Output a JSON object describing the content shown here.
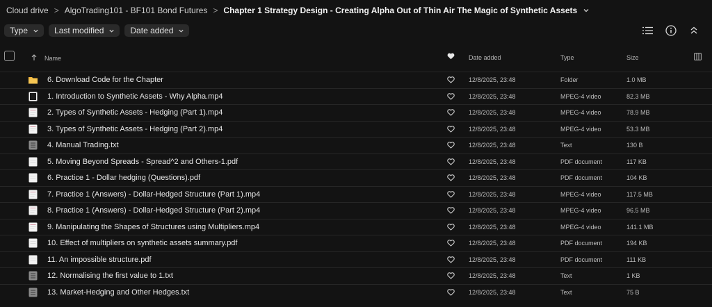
{
  "breadcrumb": {
    "items": [
      "Cloud drive",
      "AlgoTrading101 - BF101 Bond Futures",
      "Chapter 1 Strategy Design - Creating Alpha Out of Thin Air The Magic of Synthetic Assets"
    ],
    "separator": ">"
  },
  "filters": [
    "Type",
    "Last modified",
    "Date added"
  ],
  "table": {
    "headers": {
      "name": "Name",
      "date": "Date added",
      "type": "Type",
      "size": "Size"
    },
    "rows": [
      {
        "icon": "folder-icon",
        "name": "6. Download Code for the Chapter",
        "date": "12/8/2025, 23:48",
        "type": "Folder",
        "size": "1.0 MB"
      },
      {
        "icon": "video-icon-dark",
        "name": "1. Introduction to Synthetic Assets - Why Alpha.mp4",
        "date": "12/8/2025, 23:48",
        "type": "MPEG-4 video",
        "size": "82.3 MB"
      },
      {
        "icon": "video-icon",
        "name": "2. Types of Synthetic Assets - Hedging (Part 1).mp4",
        "date": "12/8/2025, 23:48",
        "type": "MPEG-4 video",
        "size": "78.9 MB"
      },
      {
        "icon": "video-icon",
        "name": "3. Types of Synthetic Assets - Hedging (Part 2).mp4",
        "date": "12/8/2025, 23:48",
        "type": "MPEG-4 video",
        "size": "53.3 MB"
      },
      {
        "icon": "text-file-icon",
        "name": "4. Manual Trading.txt",
        "date": "12/8/2025, 23:48",
        "type": "Text",
        "size": "130 B"
      },
      {
        "icon": "pdf-icon",
        "name": "5. Moving Beyond Spreads - Spread^2 and Others-1.pdf",
        "date": "12/8/2025, 23:48",
        "type": "PDF document",
        "size": "117 KB"
      },
      {
        "icon": "pdf-icon",
        "name": "6. Practice 1 - Dollar hedging (Questions).pdf",
        "date": "12/8/2025, 23:48",
        "type": "PDF document",
        "size": "104 KB"
      },
      {
        "icon": "video-icon",
        "name": "7. Practice 1 (Answers) - Dollar-Hedged Structure (Part 1).mp4",
        "date": "12/8/2025, 23:48",
        "type": "MPEG-4 video",
        "size": "117.5 MB"
      },
      {
        "icon": "video-icon",
        "name": "8. Practice 1 (Answers) - Dollar-Hedged Structure (Part 2).mp4",
        "date": "12/8/2025, 23:48",
        "type": "MPEG-4 video",
        "size": "96.5 MB"
      },
      {
        "icon": "video-icon",
        "name": "9. Manipulating the Shapes of Structures using Multipliers.mp4",
        "date": "12/8/2025, 23:48",
        "type": "MPEG-4 video",
        "size": "141.1 MB"
      },
      {
        "icon": "pdf-icon",
        "name": "10. Effect of multipliers on synthetic assets summary.pdf",
        "date": "12/8/2025, 23:48",
        "type": "PDF document",
        "size": "194 KB"
      },
      {
        "icon": "pdf-icon",
        "name": "11. An impossible structure.pdf",
        "date": "12/8/2025, 23:48",
        "type": "PDF document",
        "size": "111 KB"
      },
      {
        "icon": "text-file-icon",
        "name": "12. Normalising the first value to 1.txt",
        "date": "12/8/2025, 23:48",
        "type": "Text",
        "size": "1 KB"
      },
      {
        "icon": "text-file-icon",
        "name": "13. Market-Hedging and Other Hedges.txt",
        "date": "12/8/2025, 23:48",
        "type": "Text",
        "size": "75 B"
      }
    ]
  },
  "colors": {
    "background": "#131313",
    "folder": "#f2b43a",
    "text": "#e6e6e6",
    "muted": "#bdbdbd"
  }
}
